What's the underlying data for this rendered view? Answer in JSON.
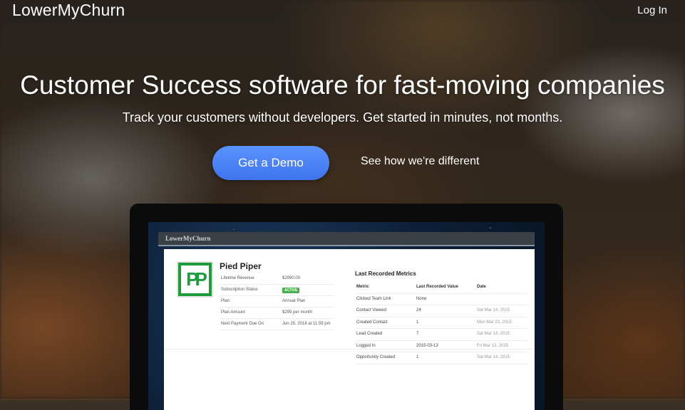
{
  "header": {
    "brand": "LowerMyChurn",
    "login": "Log In"
  },
  "hero": {
    "title": "Customer Success software for fast-moving companies",
    "subtitle": "Track your customers without developers. Get started in minutes, not months.",
    "demo_button": "Get a Demo",
    "diff_link": "See how we're different"
  },
  "app": {
    "bar_title": "LowerMyChurn",
    "logo_text": "PP",
    "company": "Pied Piper",
    "fields": [
      {
        "label": "Lifetime Revenue",
        "value": "$2990.00"
      },
      {
        "label": "Subscription Status",
        "value": "ACTIVE",
        "badge": true
      },
      {
        "label": "Plan",
        "value": "Annual Plan"
      },
      {
        "label": "Plan Amount",
        "value": "$299 per month"
      },
      {
        "label": "Next Payment Due On",
        "value": "Jun 25, 2016 at 11:59 pm"
      }
    ],
    "metrics_title": "Last Recorded Metrics",
    "metrics_headers": [
      "Metric",
      "Last Recorded Value",
      "Date"
    ],
    "metrics_rows": [
      [
        "Clicked Team Link",
        "None",
        ""
      ],
      [
        "Contact Viewed",
        "24",
        "Sat Mar 14, 2015"
      ],
      [
        "Created Contact",
        "1",
        "Mon Mar 23, 2015"
      ],
      [
        "Lead Created",
        "7",
        "Sat Mar 14, 2015"
      ],
      [
        "Logged In",
        "2015-03-13",
        "Fri Mar 13, 2015"
      ],
      [
        "Opportunity Created",
        "1",
        "Sat Mar 14, 2015"
      ]
    ]
  },
  "colors": {
    "primary_button": "#4a80f5",
    "badge": "#4caf50",
    "logo_green": "#1e9c3c"
  }
}
